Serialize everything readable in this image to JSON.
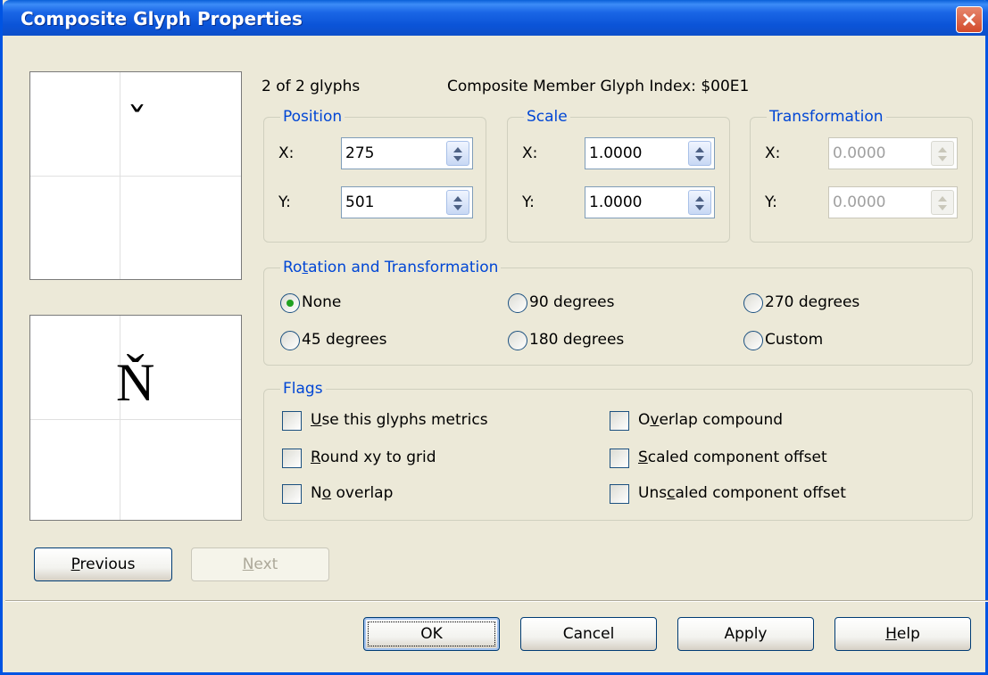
{
  "window": {
    "title": "Composite Glyph Properties",
    "close_label": "Close"
  },
  "preview": {
    "top_glyph": "ˇ",
    "bottom_glyph": "Ň"
  },
  "header": {
    "count_text": "2 of 2 glyphs",
    "index_text": "Composite Member Glyph Index: $00E1"
  },
  "position": {
    "legend": "Position",
    "x_label": "X:",
    "x_value": "275",
    "y_label": "Y:",
    "y_value": "501"
  },
  "scale": {
    "legend": "Scale",
    "x_label": "X:",
    "x_value": "1.0000",
    "y_label": "Y:",
    "y_value": "1.0000"
  },
  "transformation": {
    "legend": "Transformation",
    "x_label": "X:",
    "x_value": "0.0000",
    "y_label": "Y:",
    "y_value": "0.0000",
    "disabled": true
  },
  "rotation": {
    "legend_pre": "Ro",
    "legend_u": "t",
    "legend_post": "ation and Transformation",
    "selected": "None",
    "options": [
      "None",
      "90 degrees",
      "270 degrees",
      "45 degrees",
      "180 degrees",
      "Custom"
    ]
  },
  "flags": {
    "legend": "Flags",
    "use_metrics_u": "U",
    "use_metrics_rest": "se this glyphs metrics",
    "round_u": "R",
    "round_rest": "ound xy to grid",
    "no_overlap_pre": "N",
    "no_overlap_u": "o",
    "no_overlap_post": " overlap",
    "overlap_pre": "O",
    "overlap_u": "v",
    "overlap_post": "erlap compound",
    "scaled_u": "S",
    "scaled_rest": "caled component offset",
    "unscaled_pre": "Uns",
    "unscaled_u": "c",
    "unscaled_post": "aled component offset"
  },
  "nav": {
    "previous_u": "P",
    "previous_rest": "revious",
    "next_u": "N",
    "next_rest": "ext"
  },
  "buttons": {
    "ok": "OK",
    "cancel": "Cancel",
    "apply": "Apply",
    "help_u": "H",
    "help_rest": "elp"
  },
  "colors": {
    "titlebar": "#0b54d8",
    "legend_text": "#0046d5",
    "dialog_bg": "#ece9d8",
    "radio_selected": "#21a121"
  }
}
